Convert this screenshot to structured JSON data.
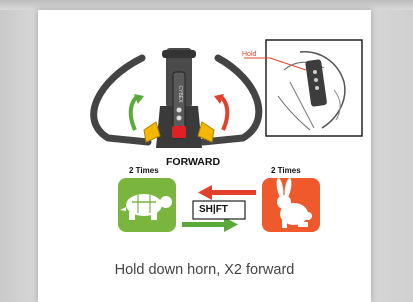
{
  "diagram": {
    "hold_label": "Hold",
    "forward_label": "FORWARD",
    "left_count": "2 Times",
    "right_count": "2 Times",
    "shift_label": "SH|FT",
    "handle_text": "CYBEX"
  },
  "caption": "Hold down horn, X2 forward",
  "colors": {
    "turtle_green": "#7ab63e",
    "rabbit_orange": "#f0592b",
    "arrow_red": "#e2402b",
    "arrow_green": "#5aaa3a",
    "handle_dark": "#3d3d3d",
    "button_yellow": "#f5b800",
    "button_red": "#e01f26"
  }
}
